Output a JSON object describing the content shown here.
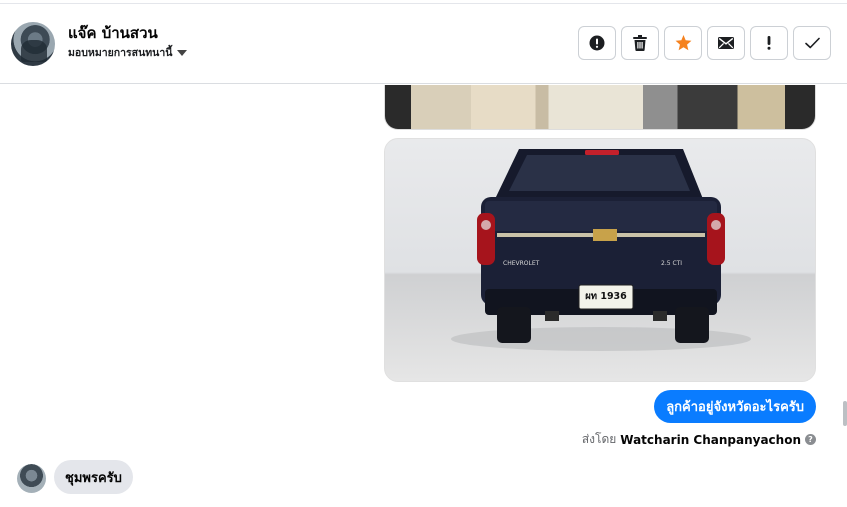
{
  "header": {
    "contact_name": "แจ๊ค บ้านสวน",
    "assign_label": "มอบหมายการสนทนานี้",
    "actions": [
      {
        "name": "mark-spam-button",
        "icon": "alert-circle-icon"
      },
      {
        "name": "delete-button",
        "icon": "trash-icon"
      },
      {
        "name": "star-button",
        "icon": "star-icon"
      },
      {
        "name": "mark-unread-button",
        "icon": "envelope-icon"
      },
      {
        "name": "follow-up-button",
        "icon": "exclamation-icon"
      },
      {
        "name": "mark-done-button",
        "icon": "check-icon"
      }
    ],
    "star_color": "#f5821f"
  },
  "messages": {
    "outgoing_text": "ลูกค้าอยู่จังหวัดอะไรครับ",
    "sent_by_prefix": "ส่งโดย",
    "sent_by_name": "Watcharin Chanpanyachon",
    "incoming_text": "ชุมพรครับ"
  },
  "car_photo": {
    "brand_text": "CHEVROLET",
    "model_badge": "2.5 CTI",
    "plate_text": "ผท 1936"
  },
  "colors": {
    "accent": "#0a7cff",
    "bubble_in": "#e4e6eb"
  }
}
